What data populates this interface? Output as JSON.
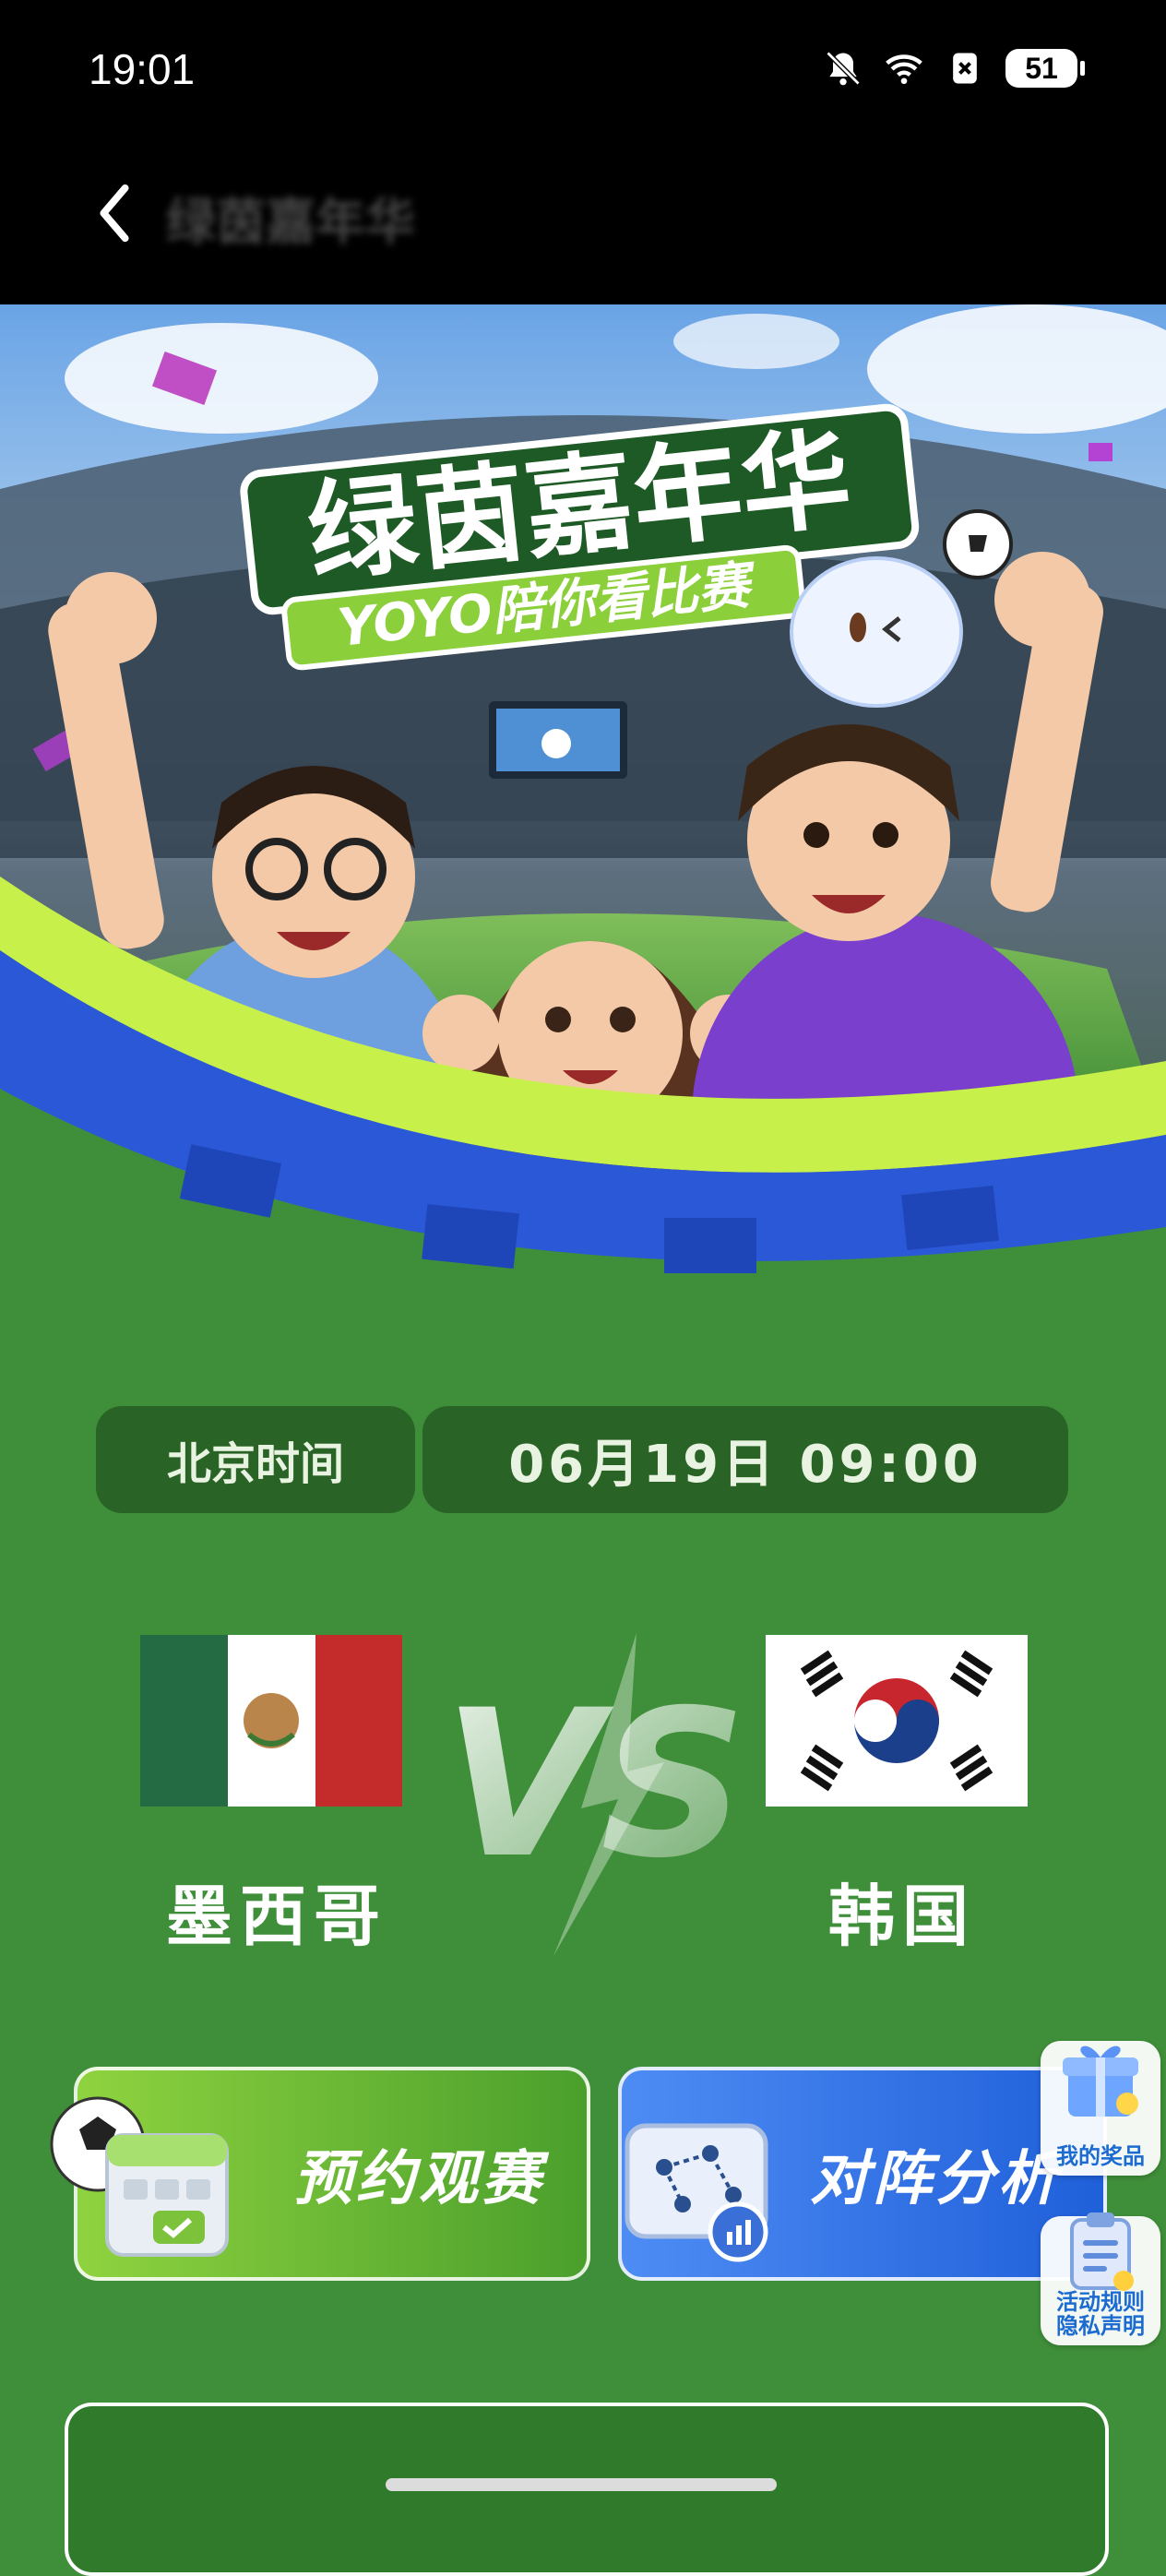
{
  "status_bar": {
    "time": "19:01",
    "battery": "51"
  },
  "header": {
    "title": "绿茵嘉年华"
  },
  "hero": {
    "title": "绿茵嘉年华",
    "subtitle": "YOYO陪你看比赛"
  },
  "match": {
    "time_label": "北京时间",
    "time_value": "06月19日 09:00",
    "team_home": "墨西哥",
    "team_away": "韩国",
    "vs": "VS"
  },
  "actions": {
    "reserve_label": "预约观赛",
    "analysis_label": "对阵分析"
  },
  "side": {
    "prize_label": "我的奖品",
    "rules_line1": "活动规则",
    "rules_line2": "隐私声明"
  },
  "colors": {
    "field_green": "#3f8f3a",
    "pill_dark": "#2a6326",
    "reserve_green": "#6bbf36",
    "analysis_blue": "#2f6fe3",
    "accent_lime": "#c8f04a"
  }
}
